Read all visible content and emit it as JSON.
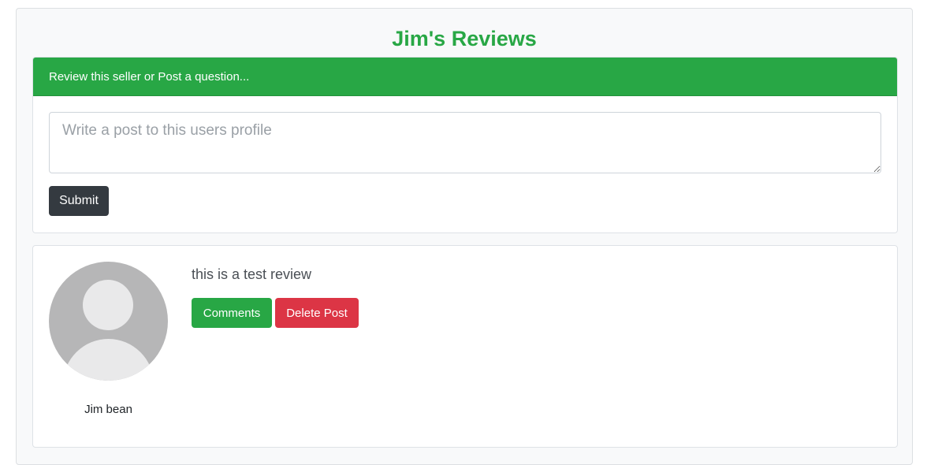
{
  "page": {
    "title": "Jim's Reviews"
  },
  "post_form": {
    "header": "Review this seller or Post a question...",
    "textarea_value": "",
    "textarea_placeholder": "Write a post to this users profile",
    "submit_label": "Submit"
  },
  "reviews": [
    {
      "author": "Jim bean",
      "text": "this is a test review",
      "comments_label": "Comments",
      "delete_label": "Delete Post"
    }
  ],
  "colors": {
    "accent": "#28a745",
    "danger": "#dc3545",
    "dark": "#343a40"
  }
}
